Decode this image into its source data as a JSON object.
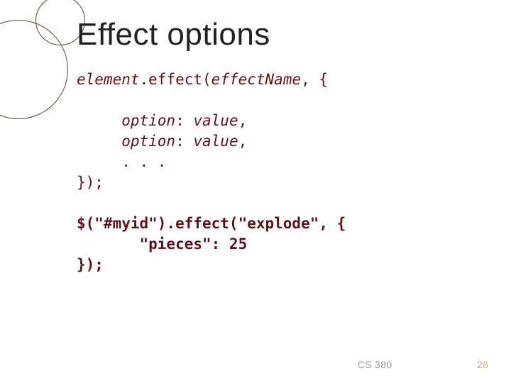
{
  "title": "Effect options",
  "codeBlock1": {
    "line1": {
      "element_italic": "element",
      "dot_effect": ".effect(",
      "effectName_italic": "effectName",
      "comma_brace": ", {"
    },
    "blankA": "",
    "opt1": {
      "indent": "     ",
      "option_italic": "option",
      "colon": ": ",
      "value_italic": "value",
      "comma": ","
    },
    "opt2": {
      "indent": "     ",
      "option_italic": "option",
      "colon": ": ",
      "value_italic": "value",
      "comma": ","
    },
    "ellipsis": {
      "indent": "     ",
      "text": ". . ."
    },
    "close": "});"
  },
  "blankB": "",
  "codeBlock2": {
    "call": "$(\"#myid\").effect(\"explode\", {",
    "inner": "       \"pieces\": 25",
    "close": "});"
  },
  "footer": {
    "course": "CS 380",
    "page": "28"
  }
}
